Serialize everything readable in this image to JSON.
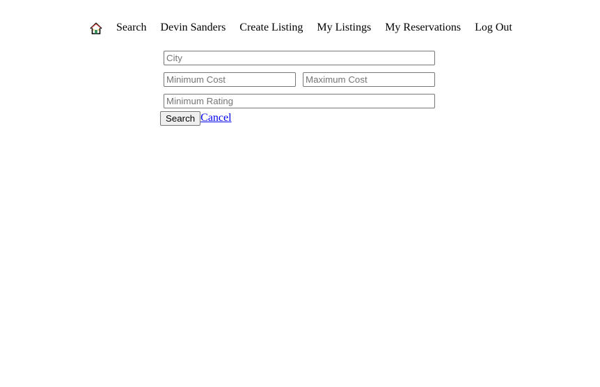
{
  "nav": {
    "home_icon": "home-icon",
    "items": [
      {
        "label": "Search"
      },
      {
        "label": "Devin Sanders"
      },
      {
        "label": "Create Listing"
      },
      {
        "label": "My Listings"
      },
      {
        "label": "My Reservations"
      },
      {
        "label": "Log Out"
      }
    ]
  },
  "search_form": {
    "city_placeholder": "City",
    "min_cost_placeholder": "Minimum Cost",
    "max_cost_placeholder": "Maximum Cost",
    "min_rating_placeholder": "Minimum Rating",
    "search_label": "Search",
    "cancel_label": "Cancel"
  },
  "colors": {
    "link": "#0000ee",
    "home_roof": "#d9534f",
    "home_door": "#2e8b57"
  }
}
